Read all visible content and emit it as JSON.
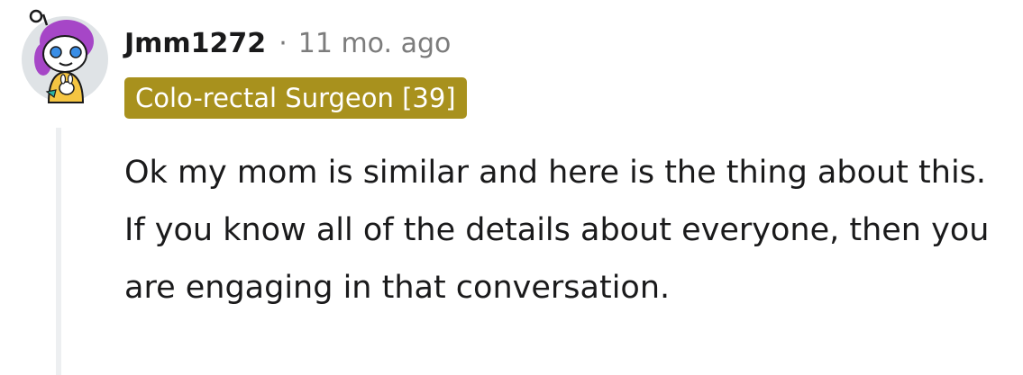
{
  "comment": {
    "author": "Jmm1272",
    "separator": "·",
    "timestamp": "11 mo. ago",
    "flair": "Colo-rectal Surgeon [39]",
    "body": "Ok my mom is similar and here is the thing about this. If you know all of the details about everyone, then you are engaging in that conversation.",
    "avatar_icon": "snoo-avatar-icon"
  },
  "colors": {
    "flair_background": "#a8911d",
    "flair_text": "#ffffff",
    "meta_text": "#7c7c7c",
    "body_text": "#1a1a1b",
    "thread_line": "#edeff1"
  }
}
